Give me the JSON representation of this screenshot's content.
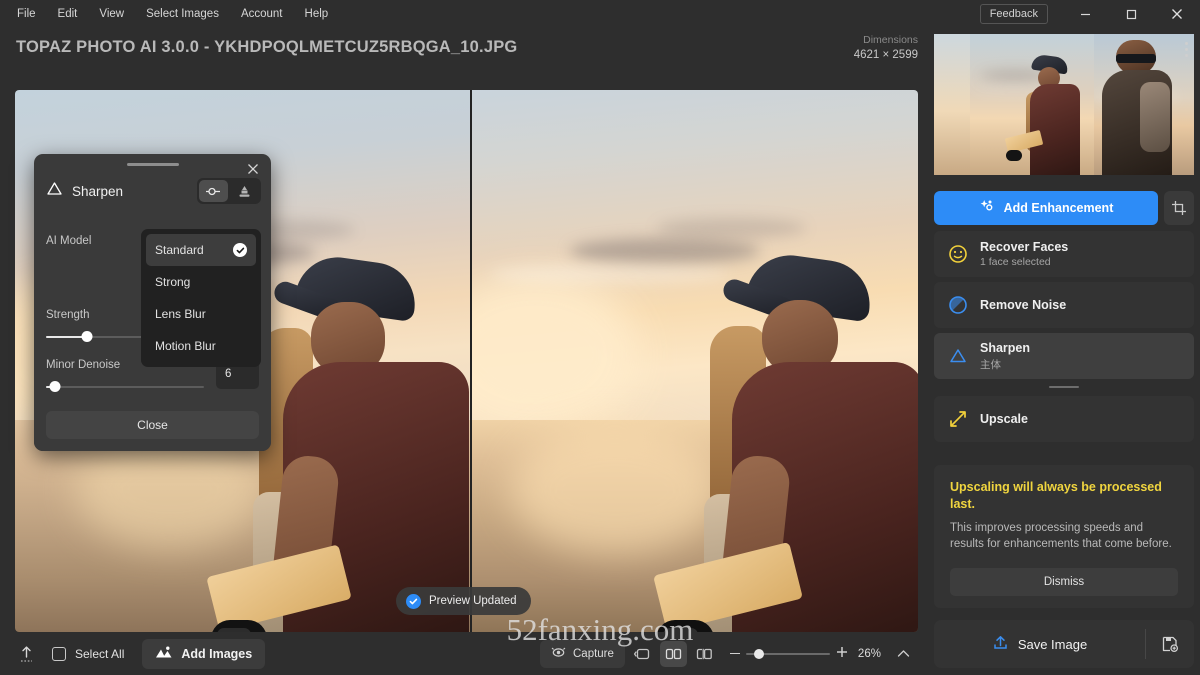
{
  "window": {
    "menu": [
      "File",
      "Edit",
      "View",
      "Select Images",
      "Account",
      "Help"
    ],
    "feedback_label": "Feedback",
    "minimize_icon": "minimize-icon",
    "maximize_icon": "maximize-icon",
    "close_icon": "close-icon"
  },
  "header": {
    "title": "TOPAZ PHOTO AI 3.0.0 - YKHDPOQLMETCUZ5RBQGA_10.JPG",
    "dimensions_label": "Dimensions",
    "dimensions_value": "4621 × 2599"
  },
  "sharpen_panel": {
    "title": "Sharpen",
    "icon": "triangle-sharpen-icon",
    "close_icon": "close-icon",
    "toggle_parameters_icon": "sliders-icon",
    "toggle_mask_icon": "brush-mask-icon",
    "model_label": "AI Model",
    "model_options": [
      "Standard",
      "Strong",
      "Lens Blur",
      "Motion Blur"
    ],
    "model_selected": "Standard",
    "sliders": [
      {
        "name": "Strength",
        "value": "26",
        "percent": 26
      },
      {
        "name": "Minor Denoise",
        "value": "6",
        "percent": 6
      }
    ],
    "close_button": "Close"
  },
  "toast": {
    "text": "Preview Updated",
    "icon": "check-circle-icon"
  },
  "watermark": "52fanxing.com",
  "sidebar": {
    "add_enhancement": "Add Enhancement",
    "add_enhancement_icon": "sparkles-icon",
    "crop_icon": "crop-icon",
    "kebab_icon": "more-vertical-icon",
    "enhancements": [
      {
        "title": "Recover Faces",
        "subtitle": "1 face selected",
        "icon": "smiley-face-icon",
        "color": "#f2d13b",
        "active": false
      },
      {
        "title": "Remove Noise",
        "subtitle": "",
        "icon": "noise-circle-icon",
        "color": "#3b8ef0",
        "active": false
      },
      {
        "title": "Sharpen",
        "subtitle": "主体",
        "icon": "triangle-sharpen-icon",
        "color": "#3b8ef0",
        "active": true
      },
      {
        "title": "Upscale",
        "subtitle": "",
        "icon": "arrows-expand-icon",
        "color": "#f2d13b",
        "active": false
      }
    ],
    "notice": {
      "heading": "Upscaling will always be processed last.",
      "body": "This improves processing speeds and results for enhancements that come before.",
      "dismiss": "Dismiss",
      "accent_color": "#f0d53f"
    },
    "save_image": "Save Image",
    "save_icon": "upload-arrow-icon",
    "save_settings_icon": "save-preset-icon"
  },
  "bottombar": {
    "upload_icon": "upload-icon",
    "select_all": "Select All",
    "add_images": "Add Images",
    "add_images_icon": "mountain-image-icon",
    "capture": "Capture",
    "capture_icon": "capture-eye-icon",
    "view_modes": [
      {
        "name": "single-view-icon",
        "active": false
      },
      {
        "name": "side-by-side-view-icon",
        "active": true
      },
      {
        "name": "split-view-icon",
        "active": false
      }
    ],
    "zoom_out_icon": "minus-icon",
    "zoom_in_icon": "plus-icon",
    "zoom_percent": "26%",
    "zoom_slider_percent": 16,
    "expand_icon": "chevron-up-icon"
  },
  "colors": {
    "accent_blue": "#2d8cf7",
    "warning_yellow": "#f0d53f",
    "panel_bg": "#3a3a3a",
    "app_bg": "#2e2e2e"
  }
}
